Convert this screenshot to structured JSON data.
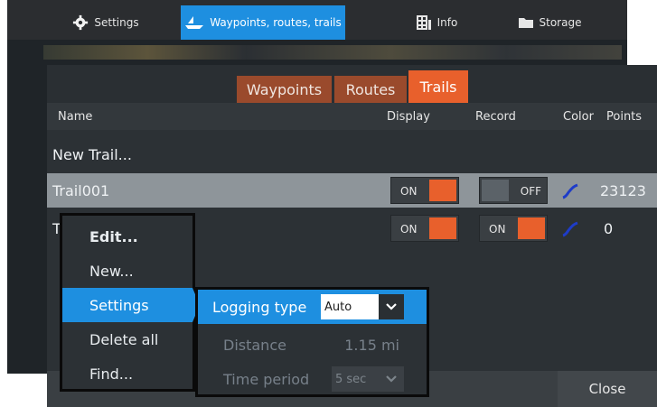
{
  "topnav": {
    "tabs": [
      {
        "label": "Settings",
        "icon": "gear-icon"
      },
      {
        "label": "Waypoints, routes, trails",
        "icon": "boat-icon"
      },
      {
        "label": "Info",
        "icon": "info-grid-icon"
      },
      {
        "label": "Storage",
        "icon": "folder-icon"
      }
    ]
  },
  "dialog": {
    "subtabs": [
      "Waypoints",
      "Routes",
      "Trails"
    ],
    "columns": {
      "name": "Name",
      "display": "Display",
      "record": "Record",
      "color": "Color",
      "points": "Points"
    },
    "new_trail": "New Trail...",
    "rows": [
      {
        "name": "Trail001",
        "display": "ON",
        "record": "OFF",
        "points": "23123"
      },
      {
        "name": "T",
        "display": "ON",
        "record": "ON",
        "points": "0"
      }
    ],
    "close_label": "Close"
  },
  "context_menu": {
    "items": [
      "Edit...",
      "New...",
      "Settings",
      "Delete all",
      "Find..."
    ]
  },
  "settings_submenu": {
    "logging_type_label": "Logging type",
    "logging_type_value": "Auto",
    "distance_label": "Distance",
    "distance_value": "1.15 mi",
    "time_period_label": "Time period",
    "time_period_value": "5 sec"
  },
  "colors": {
    "accent": "#1e8fe0",
    "toggle_on": "#e8602c",
    "trail_color": "#1e3cc8"
  }
}
